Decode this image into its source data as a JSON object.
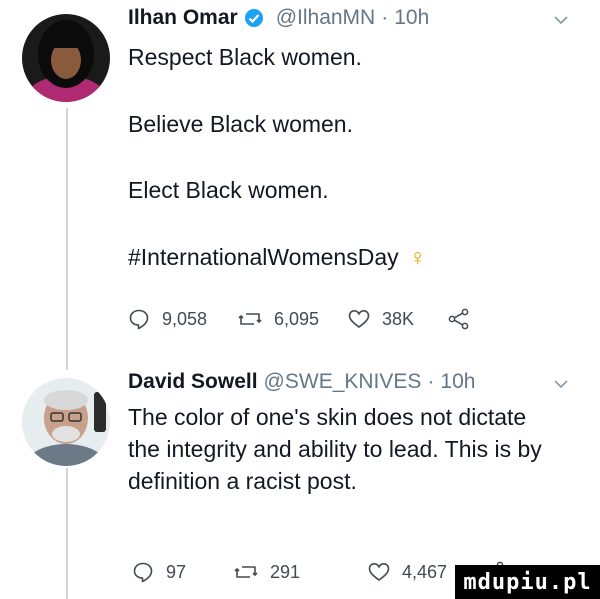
{
  "tweets": [
    {
      "name": "Ilhan Omar",
      "handle": "@IlhanMN",
      "separator": "·",
      "time": "10h",
      "lines": [
        "Respect Black women.",
        "Believe Black women.",
        "Elect Black women.",
        "#InternationalWomensDay"
      ],
      "hashtag_emoji": "♀",
      "replies": "9,058",
      "retweets": "6,095",
      "likes": "38K"
    },
    {
      "name": "David Sowell",
      "handle": "@SWE_KNIVES",
      "separator": "·",
      "time": "10h",
      "lines": [
        "The color of one's skin does not dictate",
        "the integrity and ability to lead. This is by",
        "definition a racist post."
      ],
      "replies": "97",
      "retweets": "291",
      "likes": "4,467"
    }
  ],
  "watermark": "mdupiu.pl",
  "colors": {
    "verified": "#1da1f2",
    "emoji": "#e0a800",
    "meta": "#657786"
  }
}
